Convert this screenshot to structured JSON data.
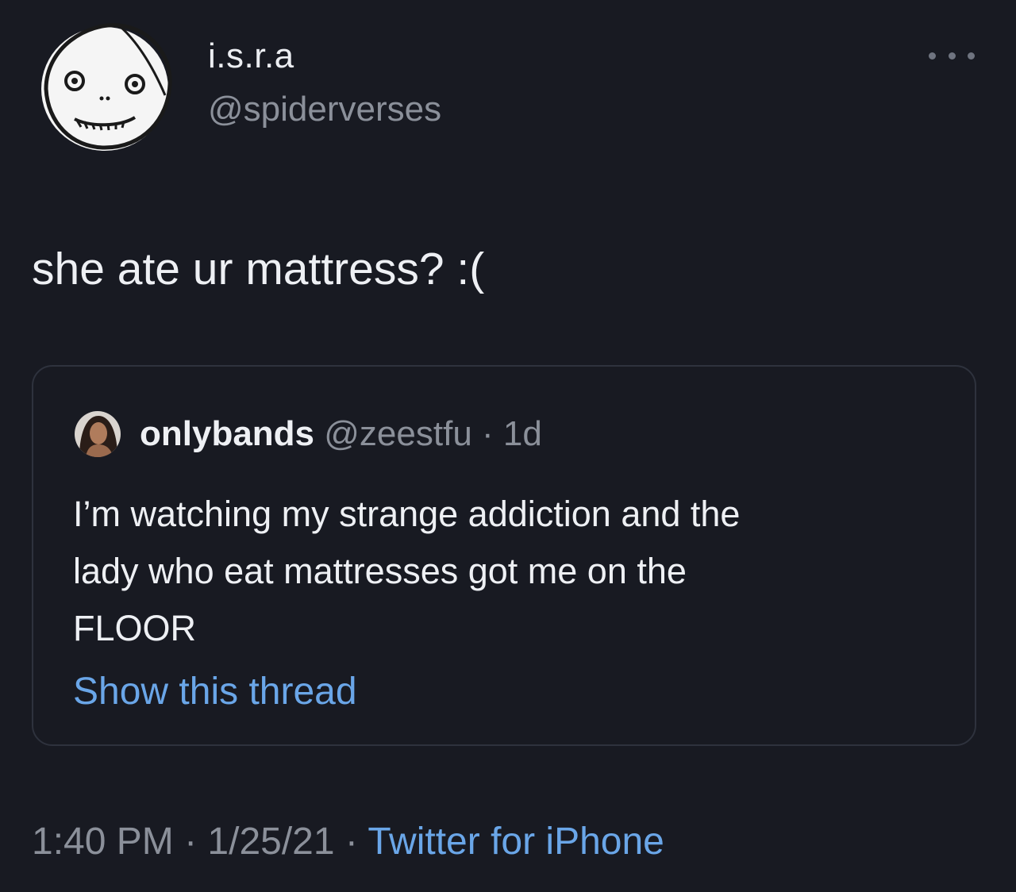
{
  "tweet": {
    "display_name": "i.s.r.a",
    "handle": "@spiderverses",
    "text": "she ate ur mattress? :(",
    "more_icon": "more-horizontal-icon",
    "avatar": "cartoon-face-avatar"
  },
  "quoted_tweet": {
    "display_name": "onlybands",
    "handle": "@zeestfu",
    "separator": " · ",
    "age": "1d",
    "avatar": "profile-photo-avatar",
    "text_lines": [
      "I’m watching my strange addiction and the",
      "lady who eat mattresses got me on the",
      "FLOOR"
    ],
    "show_thread": "Show this thread"
  },
  "meta": {
    "time": "1:40 PM",
    "separator": " · ",
    "date": "1/25/21",
    "source": "Twitter for iPhone"
  },
  "colors": {
    "background": "#181a22",
    "text": "#eef0f4",
    "secondary": "#8b909a",
    "link": "#6aa6e8",
    "border": "#2e323d"
  }
}
